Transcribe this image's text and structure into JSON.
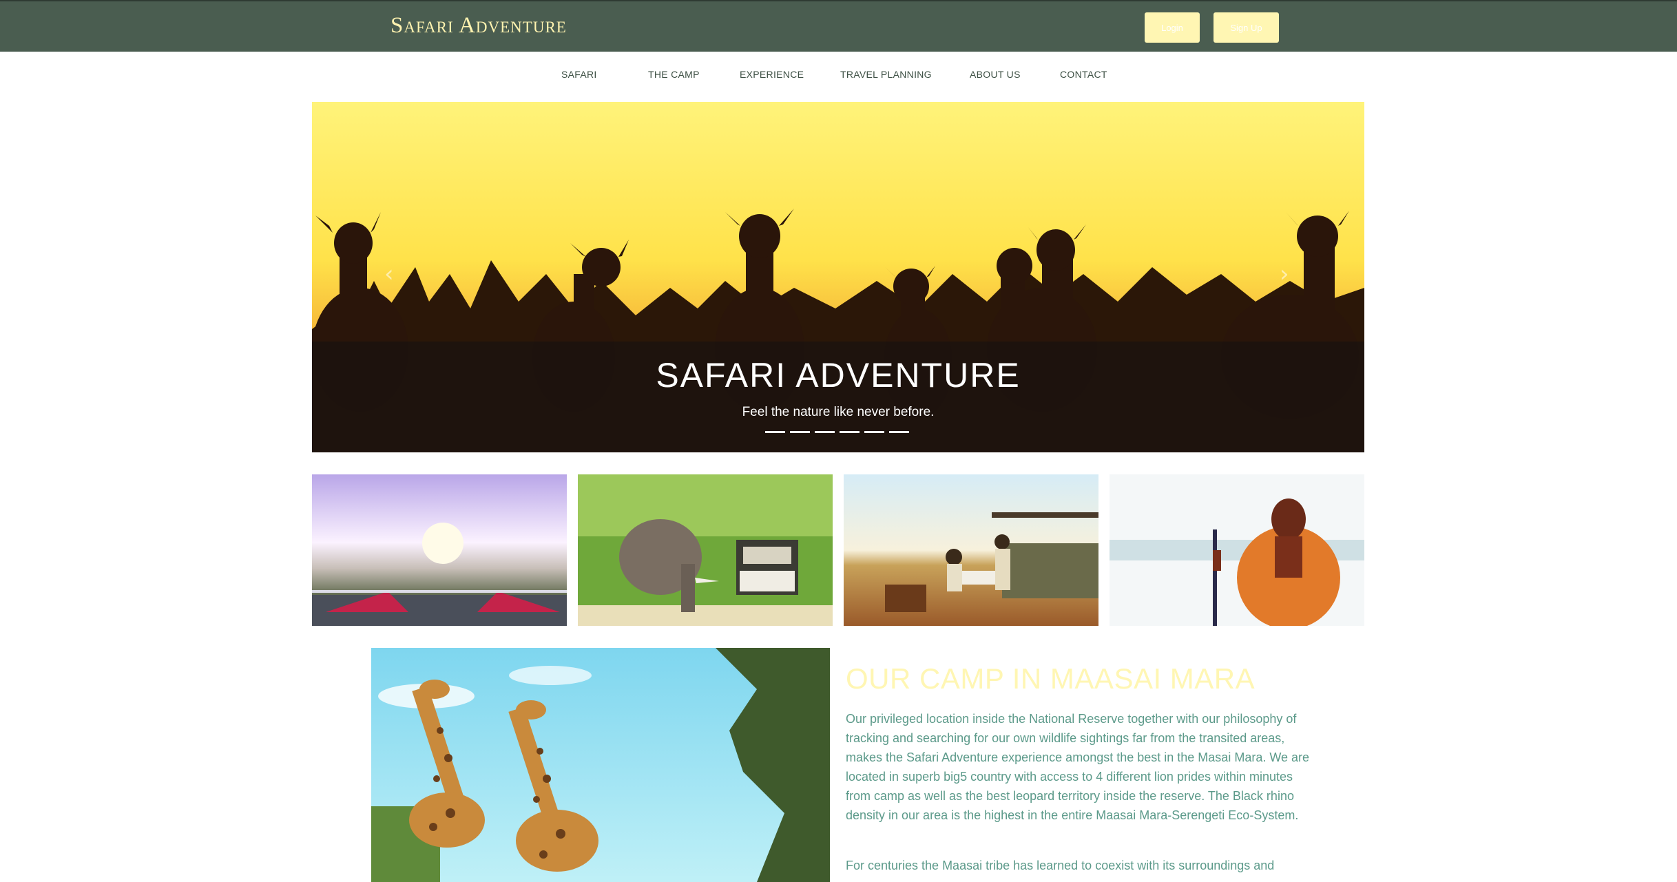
{
  "header": {
    "brand": "Safari Adventure",
    "login_label": "Login",
    "signup_label": "Sign Up"
  },
  "nav": {
    "items": [
      {
        "label": "SAFARI"
      },
      {
        "label": "THE CAMP"
      },
      {
        "label": "EXPERIENCE"
      },
      {
        "label": "TRAVEL PLANNING"
      },
      {
        "label": "ABOUT US"
      },
      {
        "label": "CONTACT"
      }
    ]
  },
  "hero": {
    "title": "SAFARI ADVENTURE",
    "subtitle": "Feel the nature like never before.",
    "slide_count": 6,
    "prev_icon": "chevron-left-icon",
    "next_icon": "chevron-right-icon"
  },
  "main": {
    "heading": "OUR CAMP IN MAASAI MARA",
    "paragraph1": "Our privileged location inside the National Reserve together with our philosophy of tracking and searching for our own wildlife sightings far from the transited areas, makes the Safari Adventure experience amongst the best in the Masai Mara. We are located in superb big5 country with access to 4 different lion prides within minutes from camp as well as the best leopard territory inside the reserve. The Black rhino density in our area is the highest in the entire Maasai Mara-Serengeti Eco-System.",
    "paragraph2": "For centuries the Maasai tribe has learned to coexist with its surroundings and"
  },
  "colors": {
    "topbar": "#4a5d50",
    "brand_text": "#fff3b0",
    "button_bg": "#fff6b3",
    "nav_text": "#3c4f43",
    "heading": "#fff6b3",
    "body_text": "#5c9a8a"
  }
}
